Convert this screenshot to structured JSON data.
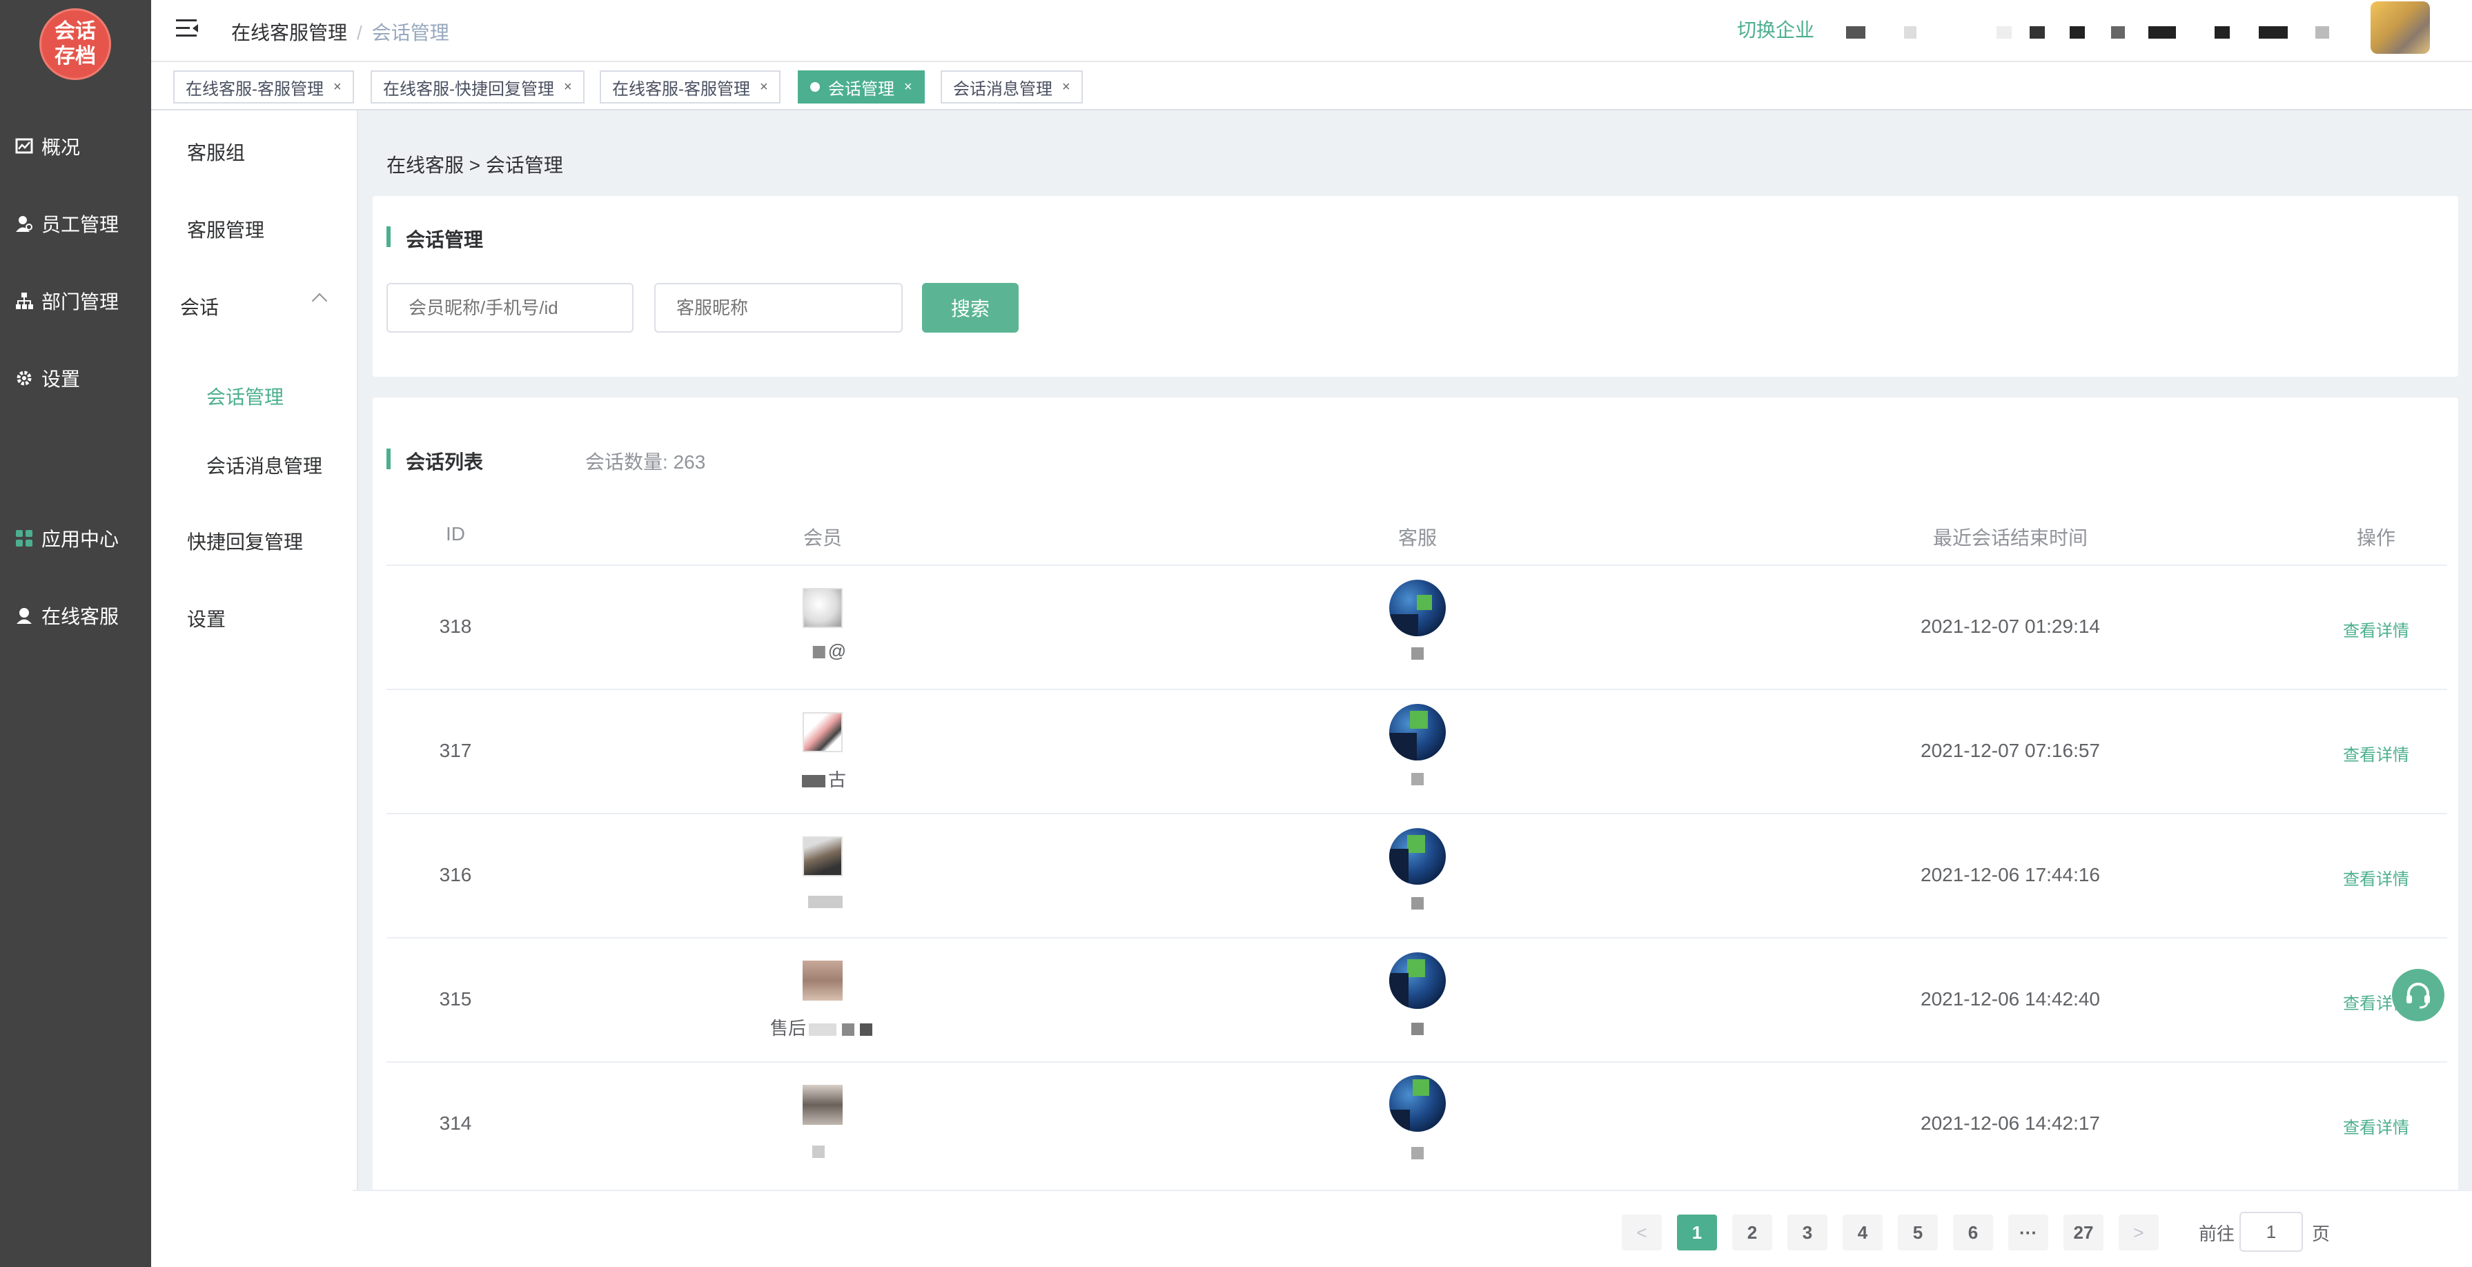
{
  "logo": {
    "line1": "会话",
    "line2": "存档"
  },
  "sidebar": {
    "items": [
      {
        "label": "概况"
      },
      {
        "label": "员工管理"
      },
      {
        "label": "部门管理"
      },
      {
        "label": "设置"
      },
      {
        "label": "应用中心"
      },
      {
        "label": "在线客服"
      }
    ]
  },
  "submenu": {
    "items": [
      "客服组",
      "客服管理",
      "会话",
      "会话管理",
      "会话消息管理",
      "快捷回复管理",
      "设置"
    ]
  },
  "header": {
    "breadcrumb_parent": "在线客服管理",
    "breadcrumb_sep": "/",
    "breadcrumb_current": "会话管理",
    "switch_label": "切换企业"
  },
  "tabs": [
    {
      "label": "在线客服-客服管理",
      "active": false
    },
    {
      "label": "在线客服-快捷回复管理",
      "active": false
    },
    {
      "label": "在线客服-客服管理",
      "active": false
    },
    {
      "label": "会话管理",
      "active": true
    },
    {
      "label": "会话消息管理",
      "active": false
    }
  ],
  "page": {
    "breadcrumb": "在线客服 > 会话管理",
    "search_card_title": "会话管理",
    "member_placeholder": "会员昵称/手机号/id",
    "agent_placeholder": "客服昵称",
    "search_button": "搜索",
    "list_title": "会话列表",
    "count_label": "会话数量:",
    "count_value": "263"
  },
  "table": {
    "columns": [
      "ID",
      "会员",
      "客服",
      "最近会话结束时间",
      "操作"
    ],
    "rows": [
      {
        "id": "318",
        "member": "@",
        "time": "2021-12-07 01:29:14",
        "action": "查看详情"
      },
      {
        "id": "317",
        "member": "古",
        "time": "2021-12-07 07:16:57",
        "action": "查看详情"
      },
      {
        "id": "316",
        "member": "",
        "time": "2021-12-06 17:44:16",
        "action": "查看详情"
      },
      {
        "id": "315",
        "member": "售后",
        "time": "2021-12-06 14:42:40",
        "action": "查看详情"
      },
      {
        "id": "314",
        "member": "",
        "time": "2021-12-06 14:42:17",
        "action": "查看详情"
      }
    ]
  },
  "pagination": {
    "prev": "<",
    "pages": [
      "1",
      "2",
      "3",
      "4",
      "5",
      "6"
    ],
    "ellipsis": "···",
    "last": "27",
    "next": ">",
    "goto_label": "前往",
    "goto_value": "1",
    "page_suffix": "页"
  },
  "colors": {
    "accent": "#4caf8f",
    "sidebar": "#434343",
    "logo": "#e6554b"
  },
  "icons": [
    "menu-toggle-icon",
    "chart-icon",
    "user-icon",
    "org-icon",
    "gear-icon",
    "apps-icon",
    "support-agent-icon",
    "close-icon",
    "headset-icon"
  ]
}
